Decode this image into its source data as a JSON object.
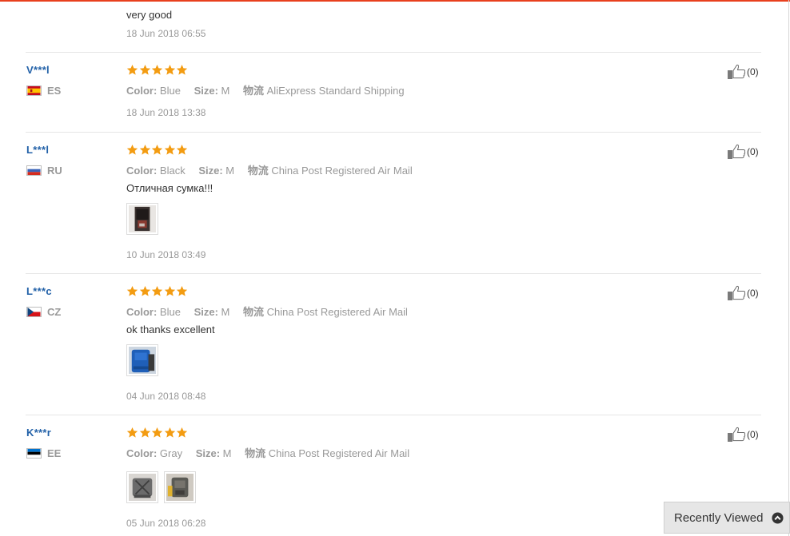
{
  "colors": {
    "accent": "#e8401e",
    "star": "#f39c12",
    "name": "#2261a8"
  },
  "top_review": {
    "text": "very good",
    "date": "18 Jun 2018 06:55"
  },
  "reviews": [
    {
      "name": "V***l",
      "country": "ES",
      "rating": 5,
      "color_label": "Color:",
      "color": "Blue",
      "size_label": "Size:",
      "size": "M",
      "ship_label": "物流",
      "shipping": "AliExpress Standard Shipping",
      "text": "",
      "date": "18 Jun 2018 13:38",
      "likes": "(0)"
    },
    {
      "name": "L***l",
      "country": "RU",
      "rating": 5,
      "color_label": "Color:",
      "color": "Black",
      "size_label": "Size:",
      "size": "M",
      "ship_label": "物流",
      "shipping": "China Post Registered Air Mail",
      "text": "Отличная сумка!!!",
      "date": "10 Jun 2018 03:49",
      "likes": "(0)"
    },
    {
      "name": "L***c",
      "country": "CZ",
      "rating": 5,
      "color_label": "Color:",
      "color": "Blue",
      "size_label": "Size:",
      "size": "M",
      "ship_label": "物流",
      "shipping": "China Post Registered Air Mail",
      "text": "ok thanks excellent",
      "date": "04 Jun 2018 08:48",
      "likes": "(0)"
    },
    {
      "name": "K***r",
      "country": "EE",
      "rating": 5,
      "color_label": "Color:",
      "color": "Gray",
      "size_label": "Size:",
      "size": "M",
      "ship_label": "物流",
      "shipping": "China Post Registered Air Mail",
      "text": "",
      "date": "05 Jun 2018 06:28",
      "likes": "(0)"
    }
  ],
  "recently_viewed": {
    "label": "Recently Viewed",
    "icon": "chevron-up-icon"
  }
}
